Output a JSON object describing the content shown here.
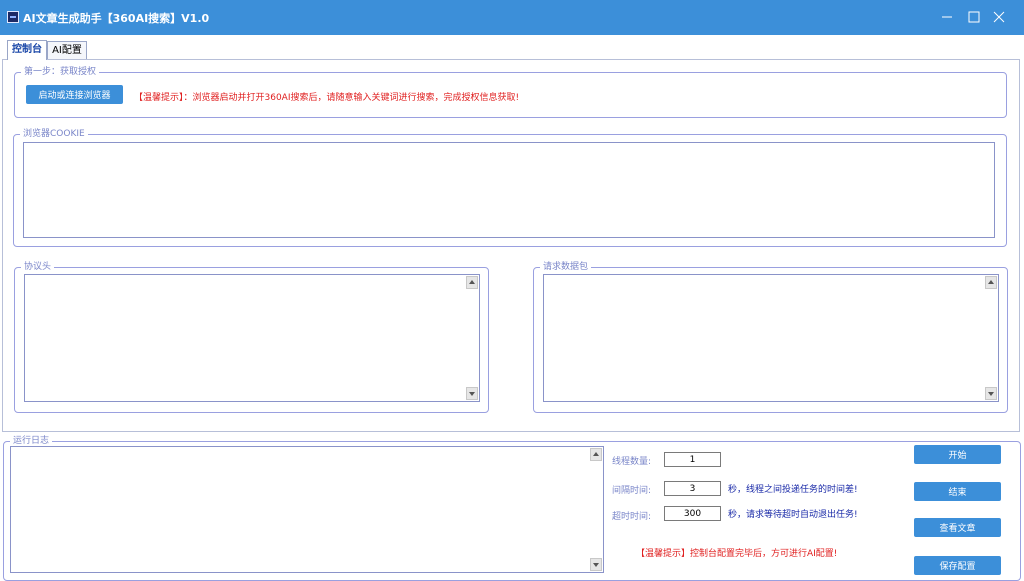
{
  "window": {
    "title": "AI文章生成助手【360AI搜索】V1.0",
    "accent": "#3c8fd9"
  },
  "tabs": {
    "console": "控制台",
    "ai_config": "AI配置"
  },
  "step1": {
    "legend": "第一步：获取授权",
    "button": "启动或连接浏览器",
    "hint": "【温馨提示】：浏览器启动并打开360AI搜索后，请随意输入关键词进行搜索，完成授权信息获取!"
  },
  "cookie": {
    "legend": "浏览器COOKIE"
  },
  "headers": {
    "legend": "协议头"
  },
  "payload": {
    "legend": "请求数据包"
  },
  "log": {
    "legend": "运行日志",
    "threads_label": "线程数量:",
    "threads_value": "1",
    "interval_label": "间隔时间:",
    "interval_value": "3",
    "interval_note": "秒，线程之间投递任务的时间差!",
    "timeout_label": "超时时间:",
    "timeout_value": "300",
    "timeout_note": "秒，请求等待超时自动退出任务!",
    "hint": "【温馨提示】控制台配置完毕后，方可进行AI配置!",
    "btn_start": "开始",
    "btn_stop": "结束",
    "btn_view": "查看文章",
    "btn_save": "保存配置"
  },
  "colors": {
    "hint_red": "#e02020",
    "note_blue": "#1a2aa8",
    "group_border": "#9aa0e0"
  }
}
